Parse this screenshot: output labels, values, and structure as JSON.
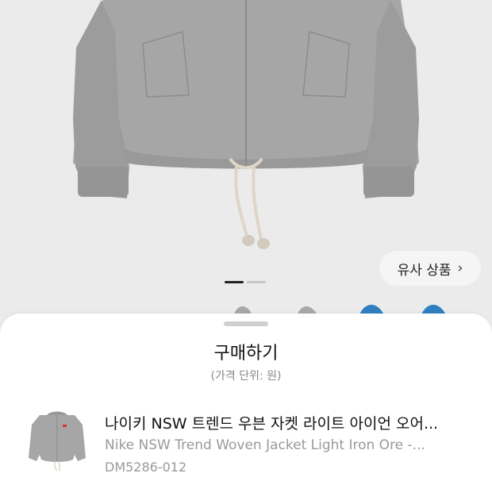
{
  "hero": {
    "image_alt": "grey jacket product photo",
    "similar_button": {
      "label": "유사 상품",
      "icon": "chevron-right-icon"
    },
    "pager": {
      "total": 2,
      "active_index": 0
    }
  },
  "sheet": {
    "title": "구매하기",
    "subtitle": "(가격 단위: 원)",
    "product": {
      "name_ko": "나이키 NSW 트렌드 우븐 자켓 라이트 아이언 오어...",
      "name_en": "Nike NSW Trend Woven Jacket Light Iron Ore -...",
      "code": "DM5286-012"
    }
  },
  "colors": {
    "jacket_grey": "#a4a4a4",
    "jacket_blue": "#2f7fc1",
    "background": "#ebebeb"
  }
}
